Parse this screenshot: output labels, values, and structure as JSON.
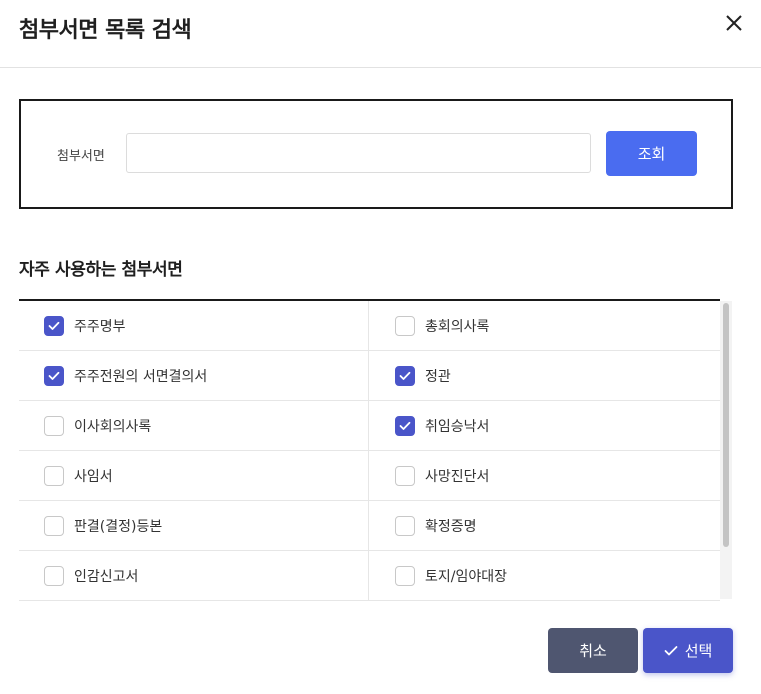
{
  "dialog": {
    "title": "첨부서면 목록 검색",
    "close_icon": "close-icon"
  },
  "search": {
    "label": "첨부서면",
    "value": "",
    "placeholder": "",
    "button_label": "조회"
  },
  "section": {
    "title": "자주 사용하는 첨부서면"
  },
  "items": [
    {
      "label": "주주명부",
      "checked": true
    },
    {
      "label": "총회의사록",
      "checked": false
    },
    {
      "label": "주주전원의 서면결의서",
      "checked": true
    },
    {
      "label": "정관",
      "checked": true
    },
    {
      "label": "이사회의사록",
      "checked": false
    },
    {
      "label": "취임승낙서",
      "checked": true
    },
    {
      "label": "사임서",
      "checked": false
    },
    {
      "label": "사망진단서",
      "checked": false
    },
    {
      "label": "판결(결정)등본",
      "checked": false
    },
    {
      "label": "확정증명",
      "checked": false
    },
    {
      "label": "인감신고서",
      "checked": false
    },
    {
      "label": "토지/임야대장",
      "checked": false
    }
  ],
  "footer": {
    "cancel_label": "취소",
    "select_label": "선택"
  },
  "colors": {
    "primary_blue": "#4a6cf0",
    "checkbox_checked": "#4a55c9",
    "cancel_button": "#4f5670",
    "select_button": "#4a55c9"
  }
}
